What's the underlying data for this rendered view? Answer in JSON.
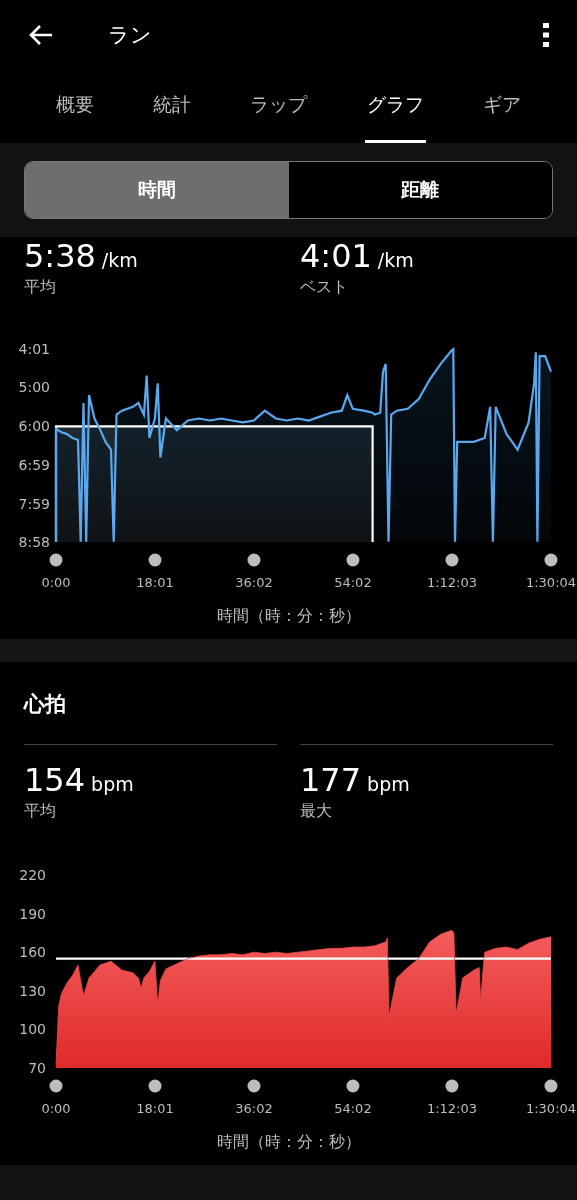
{
  "header": {
    "title": "ラン"
  },
  "tabs": [
    {
      "label": "概要",
      "selected": false
    },
    {
      "label": "統計",
      "selected": false
    },
    {
      "label": "ラップ",
      "selected": false
    },
    {
      "label": "グラフ",
      "selected": true
    },
    {
      "label": "ギア",
      "selected": false
    }
  ],
  "segments": [
    {
      "label": "時間",
      "selected": true
    },
    {
      "label": "距離",
      "selected": false
    }
  ],
  "sections": [
    {
      "kind": "pace",
      "stats": [
        {
          "value": "5:38",
          "unit": "/km",
          "label": "平均"
        },
        {
          "value": "4:01",
          "unit": "/km",
          "label": "ベスト"
        }
      ],
      "chart_data": {
        "type": "area",
        "xlabel": "時間（時：分：秒）",
        "xlim": [
          0,
          90.07
        ],
        "x": [
          0,
          0,
          1,
          2,
          3,
          4,
          4.5,
          5,
          5.5,
          6,
          7,
          8,
          9,
          10,
          10.5,
          11,
          12,
          14,
          15,
          16,
          16.5,
          17,
          18,
          18.5,
          19,
          20,
          22,
          24,
          26,
          28,
          30,
          32,
          34,
          36,
          38,
          40,
          42,
          44,
          46,
          48,
          50,
          52,
          53,
          54,
          56,
          57.6,
          57.6,
          58,
          59,
          59.5,
          60,
          60.5,
          61,
          62,
          64,
          66,
          68,
          70,
          72,
          72.3,
          72.6,
          73,
          74,
          76,
          78,
          79,
          79.5,
          80,
          82,
          84,
          86,
          87,
          87.3,
          87.6,
          88,
          89,
          90.07,
          90.07
        ],
        "series": [
          {
            "color": "#5aa9f0",
            "values": [
              8.967,
              6.07,
              6.15,
              6.2,
              6.3,
              6.35,
              8.96,
              5.4,
              8.96,
              5.2,
              5.8,
              6.08,
              6.4,
              6.6,
              8.96,
              5.7,
              5.6,
              5.5,
              5.4,
              5.7,
              4.7,
              6.3,
              5.8,
              4.9,
              6.8,
              5.8,
              6.1,
              5.85,
              5.8,
              5.85,
              5.8,
              5.85,
              5.9,
              5.85,
              5.6,
              5.8,
              5.85,
              5.8,
              5.85,
              5.75,
              5.65,
              5.6,
              5.2,
              5.55,
              5.6,
              5.65,
              5.65,
              5.7,
              5.65,
              4.6,
              4.4,
              8.96,
              5.7,
              5.6,
              5.55,
              5.3,
              4.8,
              4.4,
              4.05,
              4.02,
              8.96,
              6.4,
              6.4,
              6.4,
              6.3,
              5.5,
              8.96,
              5.5,
              6.2,
              6.6,
              5.9,
              4.9,
              4.1,
              8.96,
              4.2,
              4.2,
              4.6,
              8.967
            ]
          },
          {
            "color": "#ffffff",
            "values": [
              8.967,
              6.0,
              6.0,
              6.0,
              6.0,
              6.0,
              6.0,
              6.0,
              6.0,
              6.0,
              6.0,
              6.0,
              6.0,
              6.0,
              6.0,
              6.0,
              6.0,
              6.0,
              6.0,
              6.0,
              6.0,
              6.0,
              6.0,
              6.0,
              6.0,
              6.0,
              6.0,
              6.0,
              6.0,
              6.0,
              6.0,
              6.0,
              6.0,
              6.0,
              6.0,
              6.0,
              6.0,
              6.0,
              6.0,
              6.0,
              6.0,
              6.0,
              6.0,
              6.0,
              6.0,
              6.0,
              8.967,
              null,
              null,
              null,
              null,
              null,
              null,
              null,
              null,
              null,
              null,
              null,
              null,
              null,
              null,
              null,
              null,
              null,
              null,
              null,
              null,
              null,
              null,
              null,
              null,
              null,
              null,
              null,
              null,
              null,
              null,
              null
            ]
          }
        ],
        "xticks": [
          {
            "value": 0,
            "label": "0:00"
          },
          {
            "value": 18.02,
            "label": "18:01"
          },
          {
            "value": 36.03,
            "label": "36:02"
          },
          {
            "value": 54.03,
            "label": "54:02"
          },
          {
            "value": 72.05,
            "label": "1:12:03"
          },
          {
            "value": 90.07,
            "label": "1:30:04"
          }
        ],
        "ylim": [
          8.967,
          4.017
        ],
        "yticks": [
          {
            "value": 4.017,
            "label": "4:01"
          },
          {
            "value": 5,
            "label": "5:00"
          },
          {
            "value": 6,
            "label": "6:00"
          },
          {
            "value": 6.983,
            "label": "6:59"
          },
          {
            "value": 7.983,
            "label": "7:59"
          },
          {
            "value": 8.967,
            "label": "8:58"
          }
        ],
        "ylabel": null
      }
    },
    {
      "kind": "heart",
      "title": "心拍",
      "stats": [
        {
          "value": "154",
          "unit": "bpm",
          "label": "平均"
        },
        {
          "value": "177",
          "unit": "bpm",
          "label": "最大"
        }
      ],
      "chart_data": {
        "type": "area",
        "xlabel": "時間（時：分：秒）",
        "xlim": [
          0,
          90.07
        ],
        "x": [
          0,
          0.5,
          1,
          2,
          3,
          4,
          4.5,
          5,
          6,
          8,
          10,
          12,
          14,
          15,
          15.5,
          16,
          17,
          18,
          18.5,
          19,
          20,
          22,
          24,
          26,
          28,
          30,
          32,
          34,
          36,
          38,
          40,
          42,
          44,
          46,
          48,
          50,
          52,
          54,
          56,
          58,
          60,
          60.3,
          60.6,
          62,
          64,
          66,
          68,
          70,
          72,
          72.4,
          72.8,
          74,
          76,
          77,
          77.3,
          77.6,
          78,
          80,
          82,
          84,
          86,
          88,
          90.07
        ],
        "series": [
          {
            "color": "#ee4a4a",
            "values": [
              72,
              118,
              128,
              136,
              142,
              150,
              138,
              126,
              140,
              150,
              153,
              146,
              144,
              140,
              132,
              140,
              145,
              153,
              119,
              138,
              147,
              151,
              155,
              157,
              158,
              158,
              159,
              158,
              160,
              159,
              160,
              159,
              160,
              161,
              162,
              163,
              163,
              164,
              164,
              165,
              168,
              171,
              110,
              140,
              148,
              155,
              168,
              174,
              177,
              175,
              112,
              140,
              146,
              148,
              120,
              142,
              160,
              163,
              164,
              162,
              167,
              170,
              172
            ]
          }
        ],
        "xticks": [
          {
            "value": 0,
            "label": "0:00"
          },
          {
            "value": 18.02,
            "label": "18:01"
          },
          {
            "value": 36.03,
            "label": "36:02"
          },
          {
            "value": 54.03,
            "label": "54:02"
          },
          {
            "value": 72.05,
            "label": "1:12:03"
          },
          {
            "value": 90.07,
            "label": "1:30:04"
          }
        ],
        "ylim": [
          70,
          220
        ],
        "yticks": [
          220,
          190,
          160,
          130,
          100,
          70
        ],
        "ref_lines": [
          {
            "axis": "y",
            "value": 155
          }
        ]
      }
    }
  ]
}
